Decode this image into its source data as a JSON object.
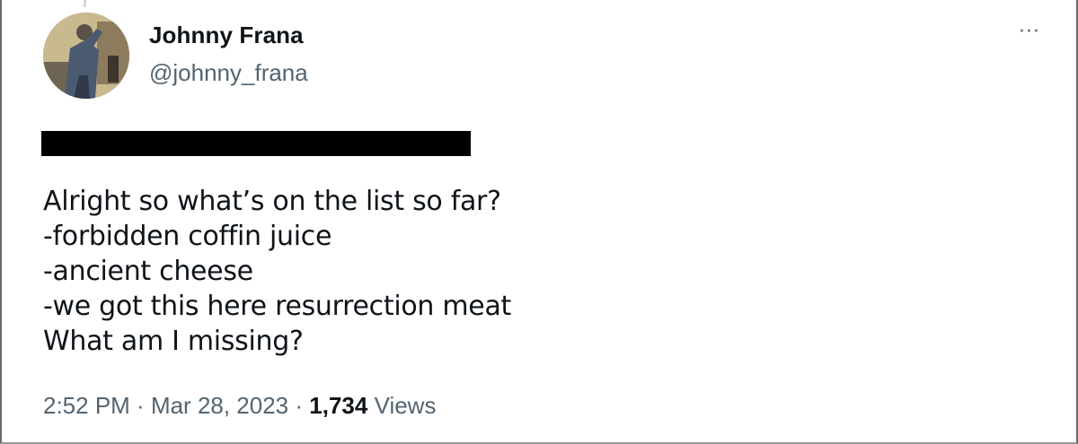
{
  "author": {
    "name": "Johnny Frana",
    "handle": "@johnny_frana"
  },
  "tweet": {
    "lines": [
      "Alright so what’s on the list so far?",
      "-forbidden coffin juice",
      "-ancient cheese",
      "-we got this here resurrection meat",
      "What am I missing?"
    ]
  },
  "meta": {
    "time": "2:52 PM",
    "separator": " · ",
    "date": "Mar 28, 2023",
    "views_count": "1,734",
    "views_label": "Views"
  },
  "more_icon": "···",
  "colors": {
    "text_primary": "#0f1419",
    "text_secondary": "#536471",
    "redaction": "#000000"
  }
}
